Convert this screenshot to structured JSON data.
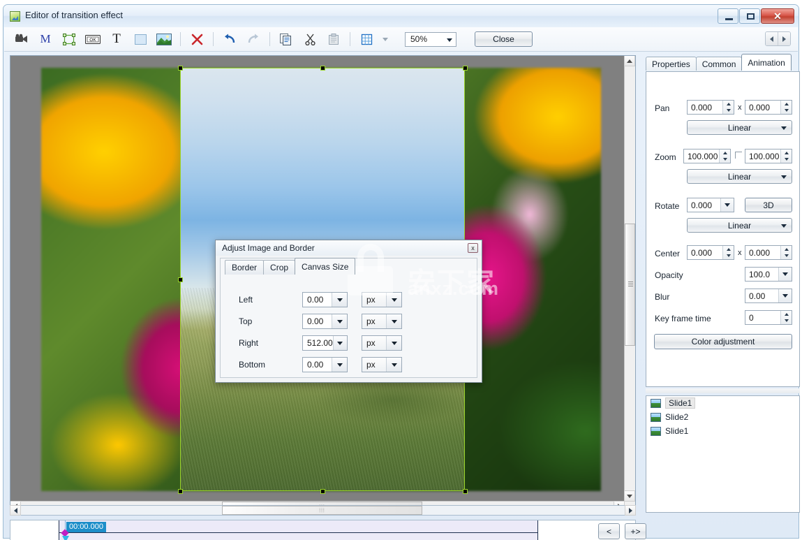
{
  "window": {
    "title": "Editor of transition effect",
    "icon": "app-chart-icon",
    "buttons": {
      "minimize": "–",
      "maximize": "□",
      "close": "✕"
    }
  },
  "toolbar": {
    "items": [
      {
        "name": "video-camera-icon",
        "label": ""
      },
      {
        "name": "mask-m-icon",
        "label": "M"
      },
      {
        "name": "selection-frame-icon",
        "label": ""
      },
      {
        "name": "ok-button-icon",
        "label": "OK"
      },
      {
        "name": "text-tool-icon",
        "label": "T"
      },
      {
        "name": "rectangle-tool-icon",
        "label": ""
      },
      {
        "name": "image-tool-icon",
        "label": ""
      }
    ],
    "delete_icon": "delete-x-icon",
    "undo_icon": "undo-icon",
    "redo_icon": "redo-icon",
    "copy_icon": "copy-icon",
    "cut_icon": "cut-scissors-icon",
    "paste_icon": "paste-icon",
    "grid_icon": "grid-icon",
    "zoom_value": "50%",
    "close_label": "Close",
    "nav_prev": "◀",
    "nav_next": "▶"
  },
  "dialog": {
    "title": "Adjust Image and Border",
    "close_label": "x",
    "tabs": [
      {
        "label": "Border",
        "active": false
      },
      {
        "label": "Crop",
        "active": false
      },
      {
        "label": "Canvas Size",
        "active": true
      }
    ],
    "fields": [
      {
        "label": "Left",
        "value": "0.00",
        "unit": "px"
      },
      {
        "label": "Top",
        "value": "0.00",
        "unit": "px"
      },
      {
        "label": "Right",
        "value": "512.00",
        "unit": "px"
      },
      {
        "label": "Bottom",
        "value": "0.00",
        "unit": "px"
      }
    ]
  },
  "watermark": {
    "main": "安下家",
    "sub": "anxz.com"
  },
  "right_panel": {
    "tabs": [
      {
        "label": "Properties",
        "active": false
      },
      {
        "label": "Common",
        "active": false
      },
      {
        "label": "Animation",
        "active": true
      }
    ],
    "pan": {
      "label": "Pan",
      "x": "0.000",
      "sep": "x",
      "y": "0.000"
    },
    "pan_mode": {
      "value": "Linear"
    },
    "zoom": {
      "label": "Zoom",
      "x": "100.000",
      "y": "100.000"
    },
    "zoom_mode": {
      "value": "Linear"
    },
    "rotate": {
      "label": "Rotate",
      "value": "0.000",
      "button": "3D"
    },
    "rotate_mode": {
      "value": "Linear"
    },
    "center": {
      "label": "Center",
      "x": "0.000",
      "sep": "x",
      "y": "0.000"
    },
    "opacity": {
      "label": "Opacity",
      "value": "100.0"
    },
    "blur": {
      "label": "Blur",
      "value": "0.00"
    },
    "key_frame_time": {
      "label": "Key frame time",
      "value": "0"
    },
    "color_adjustment": {
      "label": "Color adjustment"
    },
    "slides": [
      {
        "label": "Slide1",
        "selected": true
      },
      {
        "label": "Slide2",
        "selected": false
      },
      {
        "label": "Slide1",
        "selected": false
      }
    ]
  },
  "timeline": {
    "time_badge": "00:00.000",
    "prev_key_label": "<",
    "add_key_label": "+>"
  },
  "colors": {
    "accent_blue": "#1d8ec9",
    "selection_green": "#9bd52a",
    "keyframe_magenta": "#c21ec2",
    "close_red": "#c2402f"
  }
}
